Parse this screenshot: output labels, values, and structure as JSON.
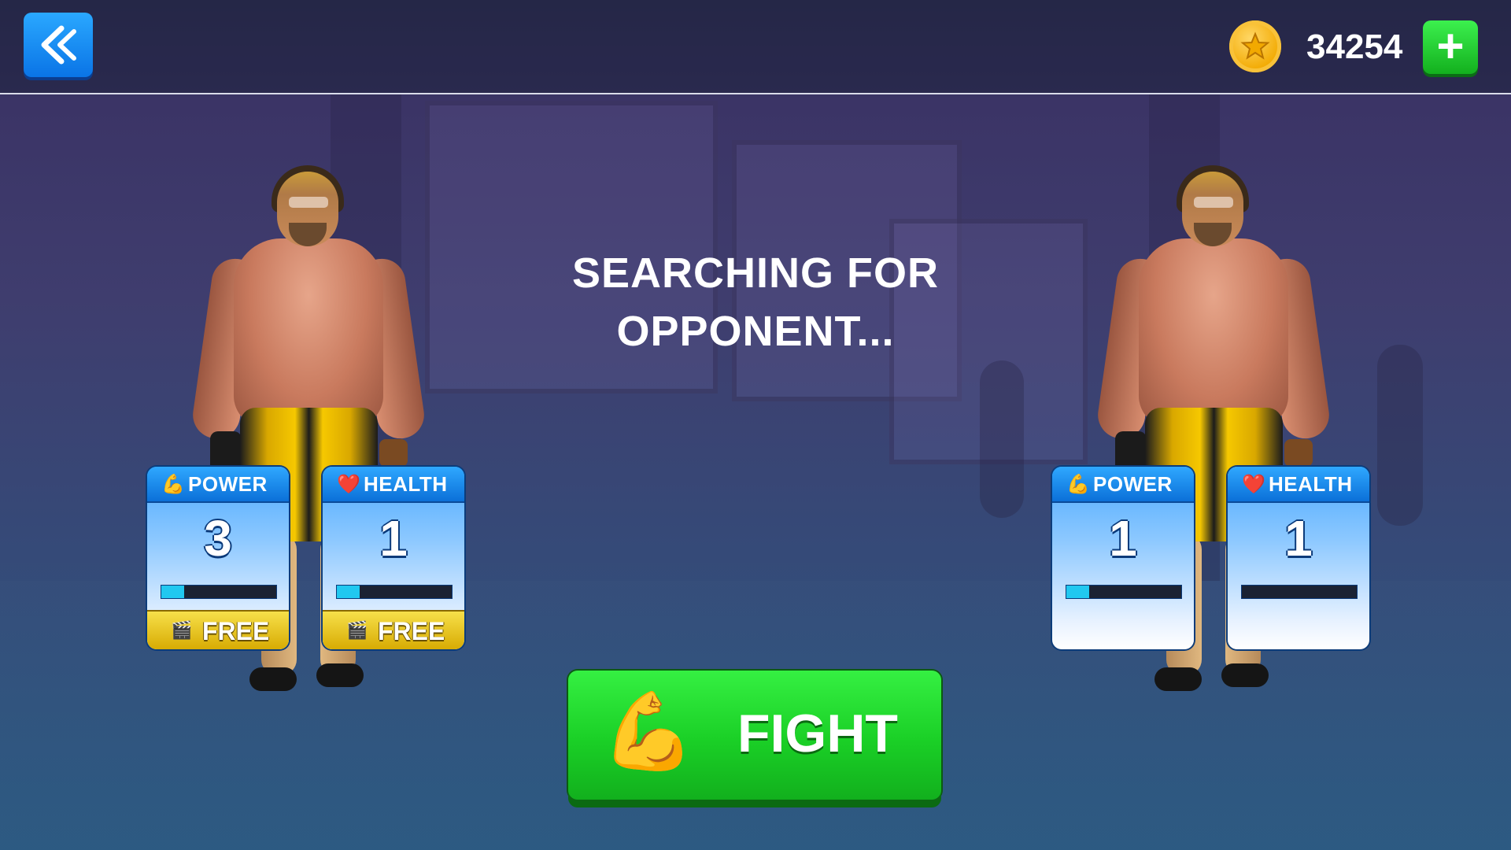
{
  "header": {
    "coin_amount": "34254",
    "add_label": "+"
  },
  "status": {
    "line1": "SEARCHING FOR",
    "line2": "OPPONENT..."
  },
  "player": {
    "power": {
      "label": "POWER",
      "value": "3",
      "level": 0.2,
      "free_label": "FREE"
    },
    "health": {
      "label": "HEALTH",
      "value": "1",
      "level": 0.2,
      "free_label": "FREE"
    }
  },
  "opponent": {
    "power": {
      "label": "POWER",
      "value": "1",
      "level": 0.2
    },
    "health": {
      "label": "HEALTH",
      "value": "1",
      "level": 0.0
    }
  },
  "fight_button": {
    "label": "FIGHT"
  },
  "icons": {
    "power": "flexed-biceps-icon",
    "health": "heart-icon",
    "free": "video-ad-icon",
    "coin": "coin-icon",
    "back": "double-chevron-left-icon"
  },
  "colors": {
    "accent_blue": "#2aa8ff",
    "accent_green": "#1acf26",
    "bar_fill": "#21c8f0",
    "free_gold": "#f7e04a"
  }
}
